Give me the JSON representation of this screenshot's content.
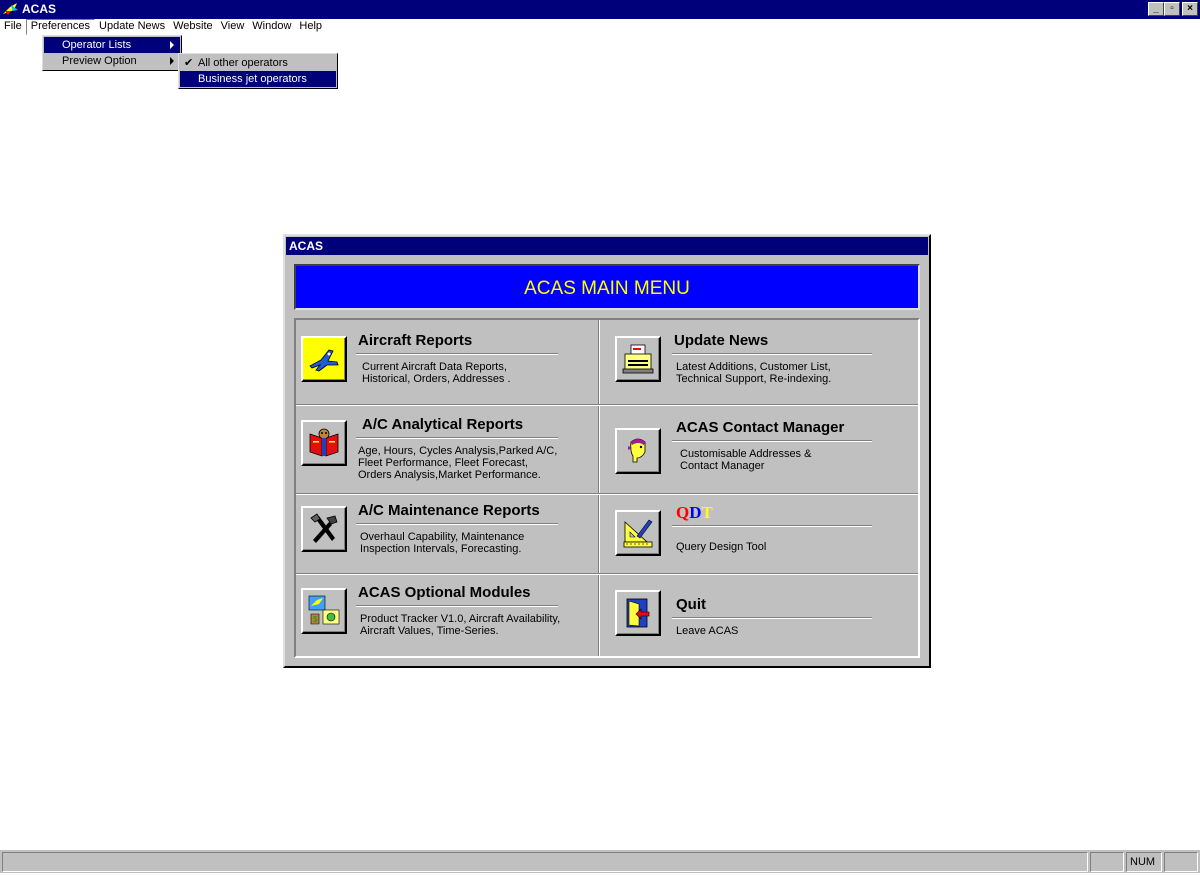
{
  "app": {
    "title": "ACAS",
    "minimize": "_",
    "restore": "▫",
    "close": "×"
  },
  "menubar": {
    "items": [
      "File",
      "Preferences",
      "Update News",
      "Website",
      "View",
      "Window",
      "Help"
    ]
  },
  "preferences_menu": {
    "items": [
      "Operator Lists",
      "Preview Option"
    ]
  },
  "operator_lists_submenu": {
    "items": [
      "All other operators",
      "Business jet operators"
    ],
    "checked": "All other operators",
    "check_mark": "✔"
  },
  "dialog": {
    "title": "ACAS",
    "banner": "ACAS MAIN MENU",
    "banner_color": "#0000ff",
    "banner_text_color": "#ffff00",
    "items": [
      {
        "title": "Aircraft Reports",
        "desc1": "Current Aircraft Data Reports,",
        "desc2": "Historical, Orders, Addresses .",
        "desc3": "",
        "icon": "airplane-icon"
      },
      {
        "title": "Update News",
        "desc1": "Latest Additions, Customer List,",
        "desc2": "Technical Support, Re-indexing.",
        "desc3": "",
        "icon": "typewriter-icon"
      },
      {
        "title": "A/C Analytical Reports",
        "desc1": "Age, Hours, Cycles Analysis,Parked A/C,",
        "desc2": "Fleet Performance, Fleet Forecast,",
        "desc3": "Orders Analysis,Market Performance.",
        "icon": "book-reader-icon"
      },
      {
        "title": "ACAS Contact Manager",
        "desc1": "Customisable Addresses &",
        "desc2": "Contact Manager",
        "desc3": "",
        "icon": "person-head-icon"
      },
      {
        "title": "A/C Maintenance Reports",
        "desc1": "Overhaul Capability, Maintenance",
        "desc2": "Inspection Intervals, Forecasting.",
        "desc3": "",
        "icon": "tools-icon"
      },
      {
        "title_q": "Q",
        "title_d": "D",
        "title_t": "T",
        "desc1": "Query Design Tool",
        "desc2": "",
        "desc3": "",
        "icon": "set-square-icon"
      },
      {
        "title": "ACAS Optional Modules",
        "desc1": "Product Tracker V1.0,  Aircraft Availability,",
        "desc2": "Aircraft Values, Time-Series.",
        "desc3": "",
        "icon": "modules-icon"
      },
      {
        "title": "Quit",
        "desc1": "Leave ACAS",
        "desc2": "",
        "desc3": "",
        "icon": "exit-door-icon"
      }
    ]
  },
  "statusbar": {
    "main": "",
    "pane1": "",
    "pane2": "NUM",
    "pane3": ""
  }
}
